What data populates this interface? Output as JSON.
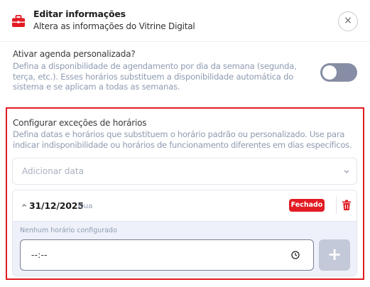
{
  "header": {
    "title": "Editar informações",
    "subtitle": "Altera as informações do Vitrine Digital",
    "close_glyph": "×",
    "icon": "briefcase-icon"
  },
  "custom_schedule": {
    "title": "Ativar agenda personalizada?",
    "description": "Defina a disponibilidade de agendamento por dia da semana (segunda, terça, etc.). Esses horários substituem a disponibilidade automática do sistema e se aplicam a todas as semanas.",
    "enabled": false
  },
  "exceptions": {
    "title": "Configurar exceções de horários",
    "description": "Defina datas e horários que substituem o horário padrão ou personalizado. Use para indicar indisponibilidade ou horários de funcionamento diferentes em dias específicos.",
    "add_date_placeholder": "Adicionar data",
    "items": [
      {
        "date": "31/12/2025",
        "weekday": "Qua",
        "status": "Fechado",
        "empty_label": "Nenhum horário configurado",
        "time_value": "--:--",
        "add_glyph": "+"
      }
    ]
  },
  "colors": {
    "accent": "#e21b23",
    "toggle_off": "#868da4",
    "muted_text": "#8e9ab0",
    "add_button_disabled": "#c4c9d9"
  }
}
